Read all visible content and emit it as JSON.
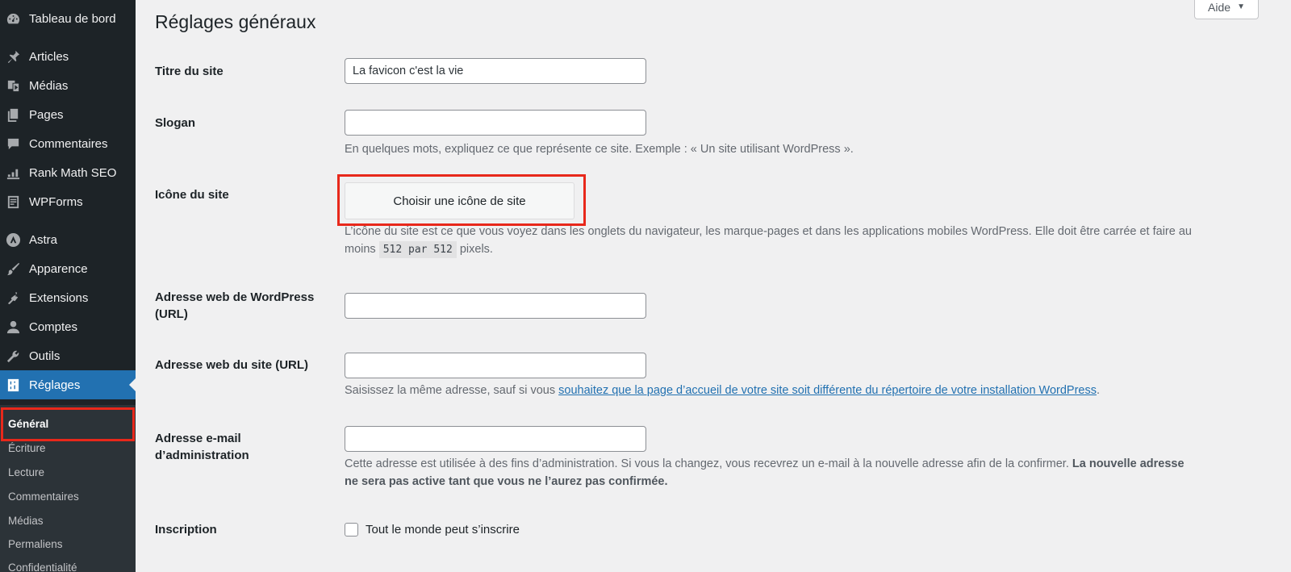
{
  "sidebar": {
    "items": [
      {
        "label": "Tableau de bord",
        "icon": "dashboard-icon"
      },
      {
        "label": "Articles",
        "icon": "pin-icon"
      },
      {
        "label": "Médias",
        "icon": "media-icon"
      },
      {
        "label": "Pages",
        "icon": "pages-icon"
      },
      {
        "label": "Commentaires",
        "icon": "comment-icon"
      },
      {
        "label": "Rank Math SEO",
        "icon": "chart-icon"
      },
      {
        "label": "WPForms",
        "icon": "forms-icon"
      },
      {
        "label": "Astra",
        "icon": "astra-icon"
      },
      {
        "label": "Apparence",
        "icon": "brush-icon"
      },
      {
        "label": "Extensions",
        "icon": "plugin-icon"
      },
      {
        "label": "Comptes",
        "icon": "user-icon"
      },
      {
        "label": "Outils",
        "icon": "wrench-icon"
      },
      {
        "label": "Réglages",
        "icon": "settings-icon"
      }
    ],
    "submenu": [
      "Général",
      "Écriture",
      "Lecture",
      "Commentaires",
      "Médias",
      "Permaliens",
      "Confidentialité"
    ]
  },
  "header": {
    "help_label": "Aide",
    "help_arrow": "▼",
    "title": "Réglages généraux"
  },
  "form": {
    "site_title_label": "Titre du site",
    "site_title_value": "La favicon c'est la vie",
    "tagline_label": "Slogan",
    "tagline_value": "",
    "tagline_desc": "En quelques mots, expliquez ce que représente ce site. Exemple : « Un site utilisant WordPress ».",
    "site_icon_label": "Icône du site",
    "site_icon_button": "Choisir une icône de site",
    "site_icon_desc_1": "L’icône du site est ce que vous voyez dans les onglets du navigateur, les marque-pages et dans les applications mobiles WordPress. Elle doit être carrée et faire au",
    "site_icon_desc_2a": "moins",
    "site_icon_desc_code": "512 par 512",
    "site_icon_desc_2b": "pixels.",
    "wp_url_label": "Adresse web de WordPress (URL)",
    "wp_url_value": "",
    "site_url_label": "Adresse web du site (URL)",
    "site_url_value": "",
    "site_url_desc_a": "Saisissez la même adresse, sauf si vous",
    "site_url_desc_link": "souhaitez que la page d’accueil de votre site soit différente du répertoire de votre installation WordPress",
    "site_url_desc_b": ".",
    "admin_email_label": "Adresse e-mail d’administration",
    "admin_email_value": "",
    "admin_email_desc": "Cette adresse est utilisée à des fins d’administration. Si vous la changez, vous recevrez un e-mail à la nouvelle adresse afin de la confirmer.",
    "admin_email_desc_bold_1": "La nouvelle adresse",
    "admin_email_desc_bold_2": "ne sera pas active tant que vous ne l’aurez pas confirmée.",
    "membership_label": "Inscription",
    "membership_checkbox": "Tout le monde peut s’inscrire"
  },
  "colors": {
    "sidebar_bg": "#1d2327",
    "active_blue": "#2271b1",
    "highlight_red": "#e8281b"
  }
}
